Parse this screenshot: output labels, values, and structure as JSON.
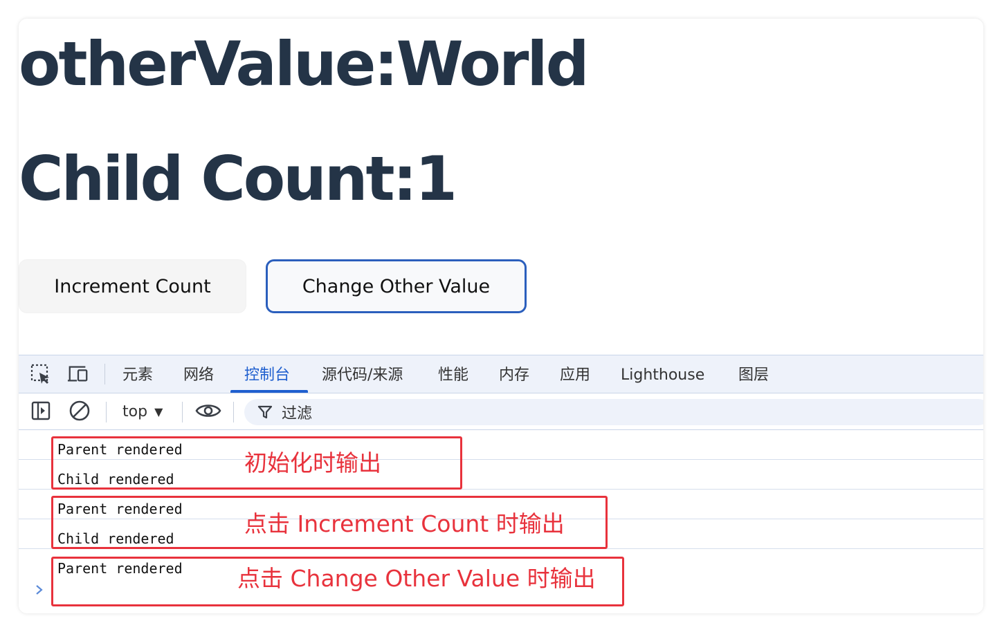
{
  "page": {
    "heading_other": "otherValue:World",
    "heading_child": "Child Count:1",
    "buttons": {
      "increment": "Increment Count",
      "change_other": "Change Other Value"
    }
  },
  "devtools": {
    "tabs": [
      "元素",
      "网络",
      "控制台",
      "源代码/来源",
      "性能",
      "内存",
      "应用",
      "Lighthouse",
      "图层"
    ],
    "active_tab": "控制台",
    "toolbar_icons": [
      "inspect-element-icon",
      "device-toolbar-icon"
    ],
    "console_toolbar": {
      "context": "top",
      "filter_placeholder": "过滤"
    },
    "logs": [
      "Parent rendered",
      "Child rendered",
      "Parent rendered",
      "Child rendered",
      "Parent rendered"
    ]
  },
  "annotations": [
    "初始化时输出",
    "点击 Increment Count  时输出",
    "点击 Change Other Value  时输出"
  ],
  "colors": {
    "heading": "#243447",
    "accent": "#1f5fcf",
    "annotation": "#e8323c",
    "button_focus_border": "#2b5fbd"
  }
}
